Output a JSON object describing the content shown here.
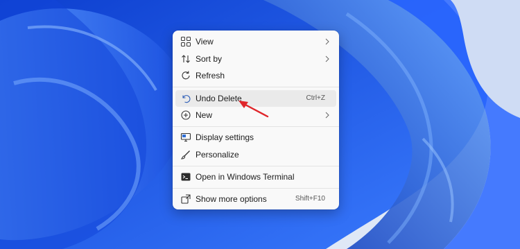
{
  "context_menu": {
    "items": [
      {
        "label": "View",
        "icon": "view-grid-icon",
        "submenu": true
      },
      {
        "label": "Sort by",
        "icon": "sort-icon",
        "submenu": true
      },
      {
        "label": "Refresh",
        "icon": "refresh-icon"
      },
      {
        "label": "Undo Delete",
        "icon": "undo-icon",
        "shortcut": "Ctrl+Z",
        "highlighted": true
      },
      {
        "label": "New",
        "icon": "add-icon",
        "submenu": true
      },
      {
        "label": "Display settings",
        "icon": "display-icon"
      },
      {
        "label": "Personalize",
        "icon": "brush-icon"
      },
      {
        "label": "Open in Windows Terminal",
        "icon": "terminal-icon"
      },
      {
        "label": "Show more options",
        "icon": "more-options-icon",
        "shortcut": "Shift+F10"
      }
    ]
  },
  "colors": {
    "wallpaper_base": "#1f63f0",
    "menu_bg": "#f9f9f9",
    "highlight": "#eaeaea",
    "annotation_arrow": "#e0262b"
  }
}
